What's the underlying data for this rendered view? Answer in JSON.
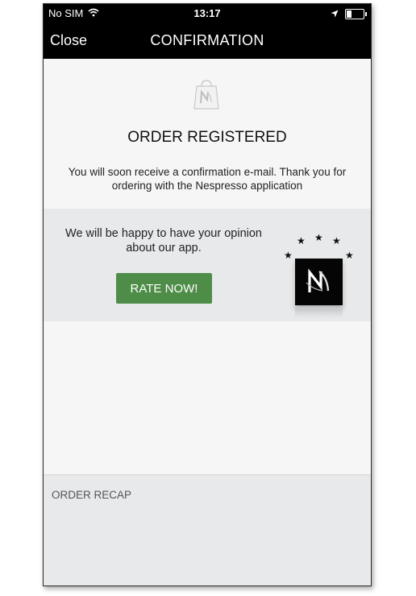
{
  "statusbar": {
    "carrier": "No SIM",
    "time": "13:17",
    "icons": [
      "wifi-icon",
      "location-arrow-icon",
      "battery-icon"
    ]
  },
  "navbar": {
    "close_label": "Close",
    "title": "CONFIRMATION"
  },
  "confirmation": {
    "icon": "shopping-bag-icon",
    "heading": "ORDER REGISTERED",
    "message_line1": "You will soon receive a confirmation e-mail. Thank you for",
    "message_line2": "ordering with the Nespresso application"
  },
  "rating": {
    "text_line1": "We will be happy to have your opinion",
    "text_line2": "about our app.",
    "button_label": "RATE NOW!",
    "stars_count": 5,
    "button_color": "#4e8d48",
    "logo_icon": "nespresso-logo-icon"
  },
  "recap": {
    "label": "ORDER RECAP"
  }
}
